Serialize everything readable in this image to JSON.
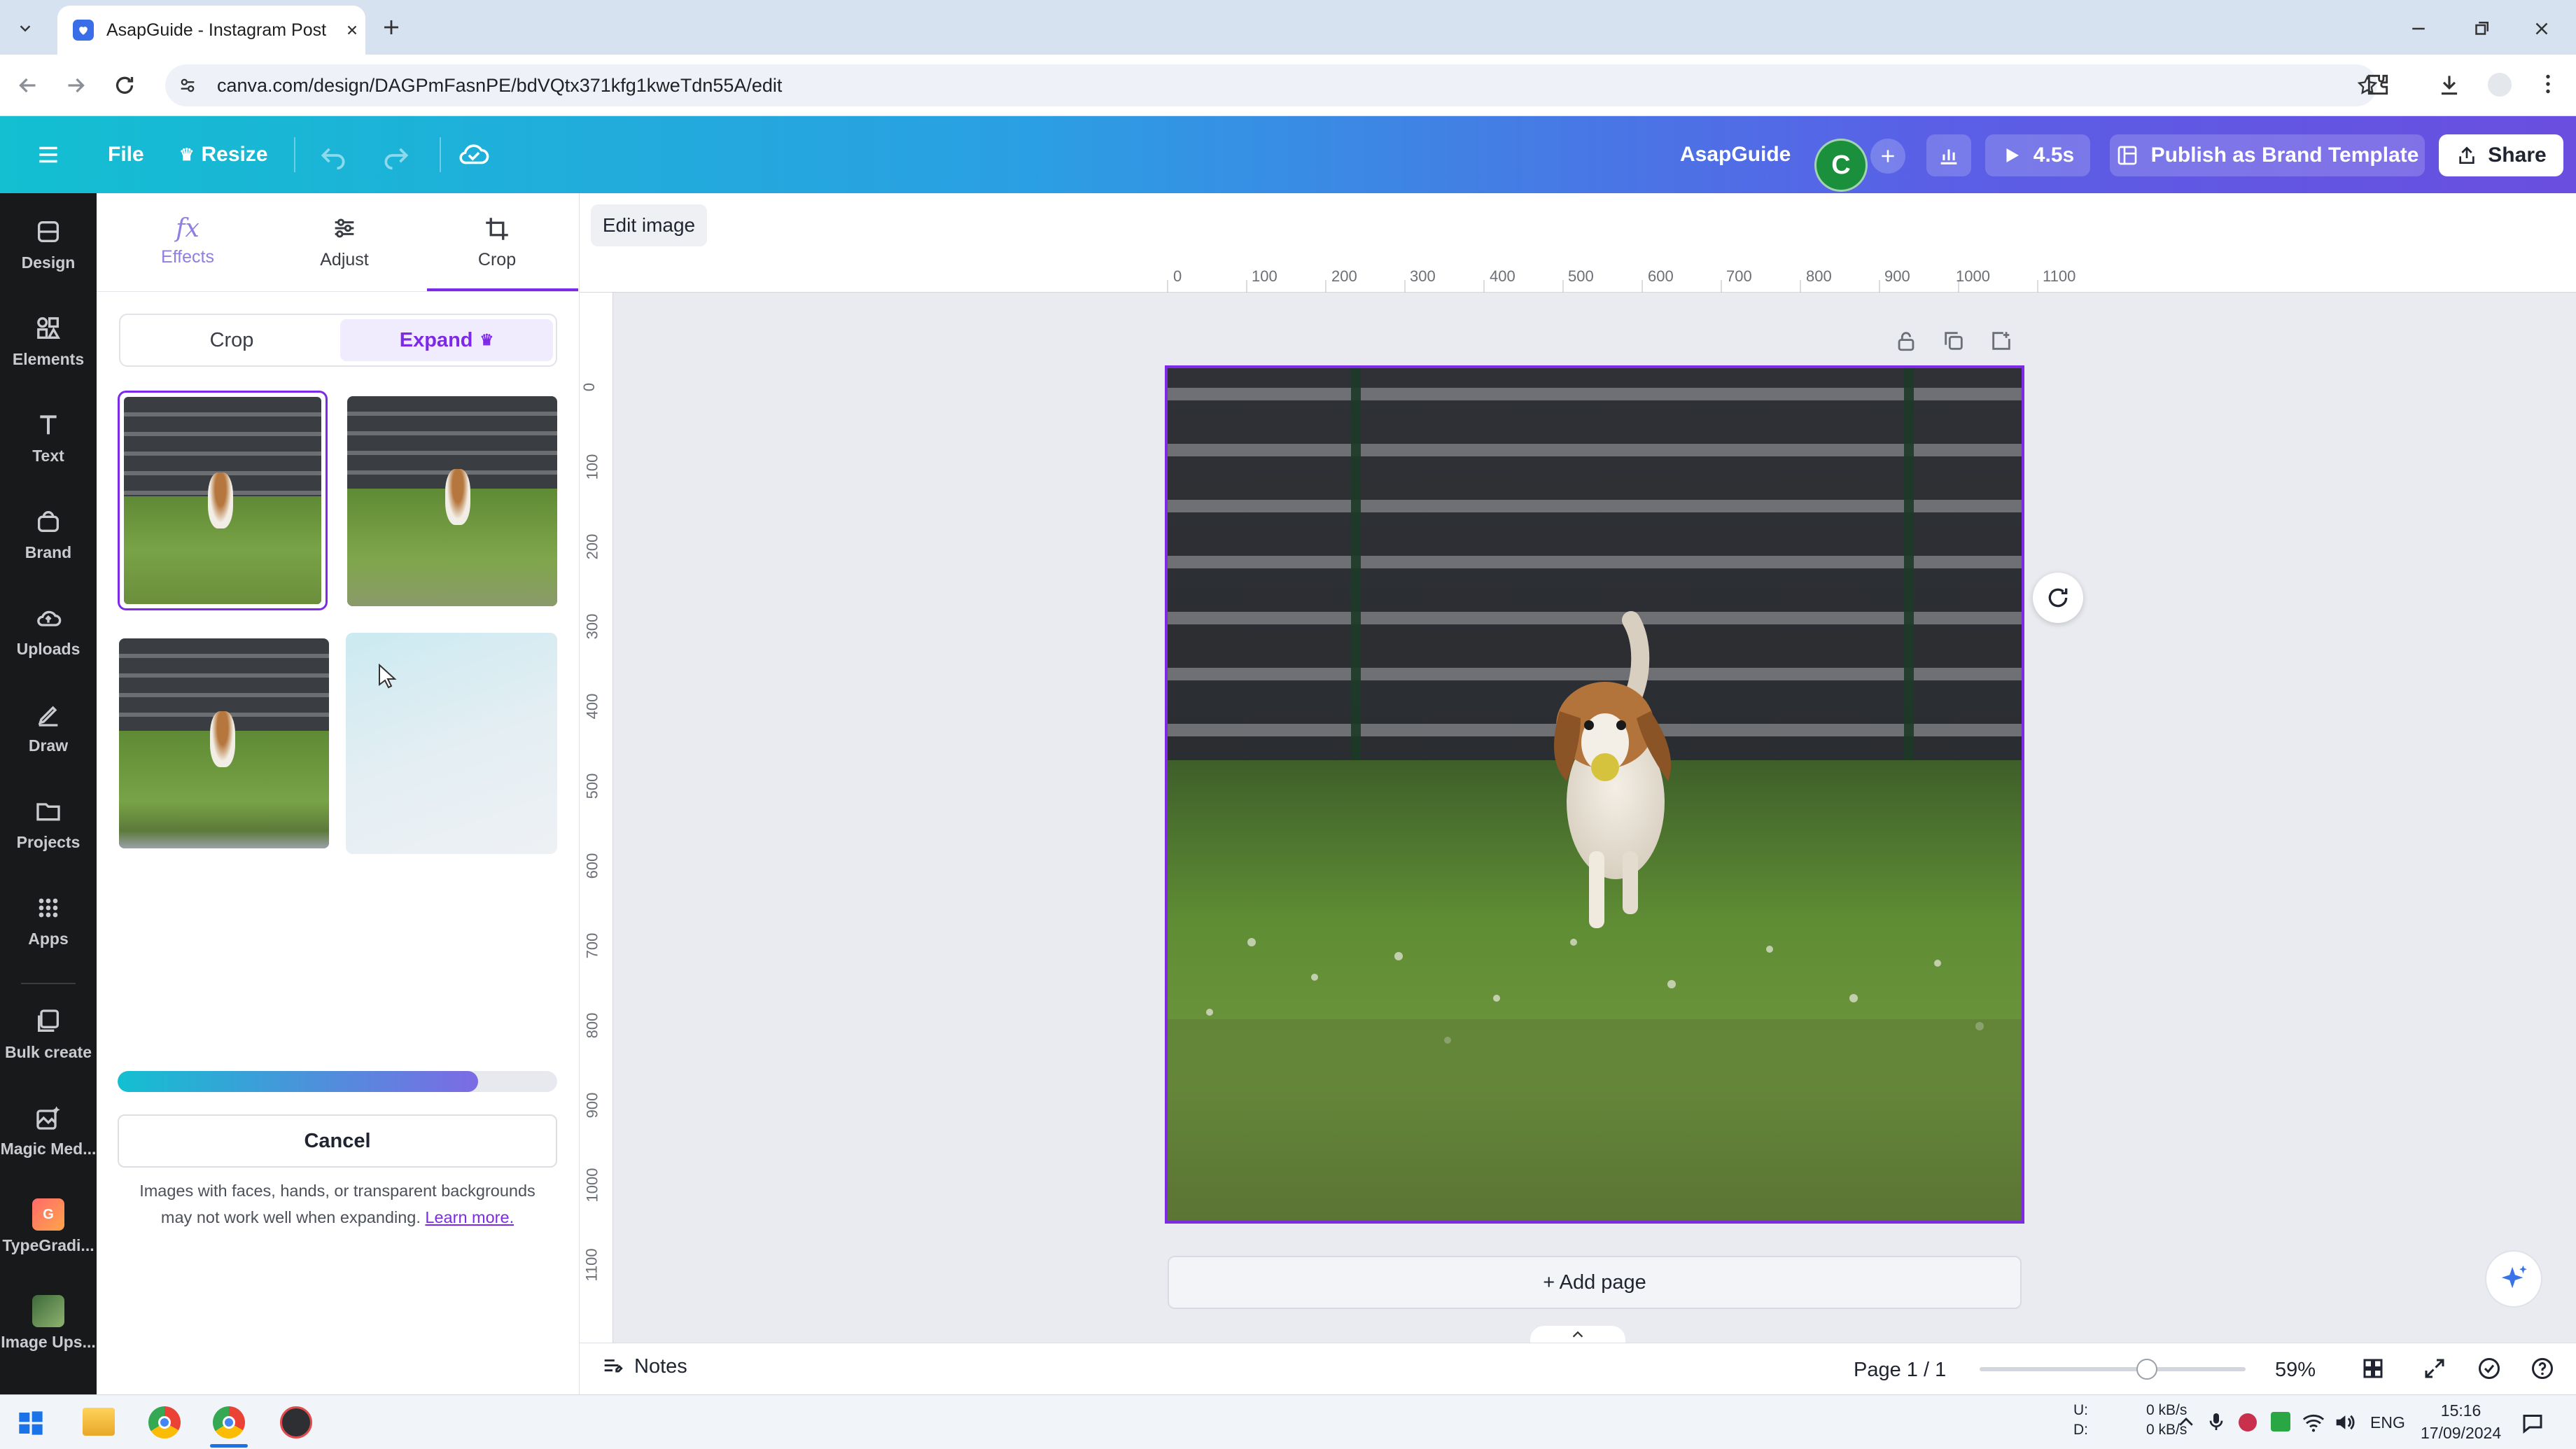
{
  "browser": {
    "tab_title": "AsapGuide - Instagram Post",
    "url": "canva.com/design/DAGPmFasnPE/bdVQtx371kfg1kweTdn55A/edit"
  },
  "header": {
    "file": "File",
    "resize": "Resize",
    "brand_name": "AsapGuide",
    "avatar_letter": "C",
    "play_time": "4.5s",
    "publish": "Publish as Brand Template",
    "share": "Share"
  },
  "rail": {
    "items": [
      {
        "label": "Design"
      },
      {
        "label": "Elements"
      },
      {
        "label": "Text"
      },
      {
        "label": "Brand"
      },
      {
        "label": "Uploads"
      },
      {
        "label": "Draw"
      },
      {
        "label": "Projects"
      },
      {
        "label": "Apps"
      },
      {
        "label": "Bulk create"
      },
      {
        "label": "Magic Med..."
      },
      {
        "label": "TypeGradi..."
      },
      {
        "label": "Image Ups..."
      }
    ]
  },
  "panel": {
    "tabs": [
      {
        "label": "Effects"
      },
      {
        "label": "Adjust"
      },
      {
        "label": "Crop"
      }
    ],
    "segment": {
      "crop": "Crop",
      "expand": "Expand"
    },
    "progress": 0.82,
    "cancel": "Cancel",
    "note": "Images with faces, hands, or transparent backgrounds may not work well when expanding.",
    "learn_more": "Learn more."
  },
  "canvas": {
    "edit_image": "Edit image",
    "ruler_top": [
      "0",
      "100",
      "200",
      "300",
      "400",
      "500",
      "600",
      "700",
      "800",
      "900",
      "1000",
      "1100"
    ],
    "ruler_left": [
      "0",
      "100",
      "200",
      "300",
      "400",
      "500",
      "600",
      "700",
      "800",
      "900",
      "1000",
      "1100"
    ],
    "add_page": "+ Add page"
  },
  "footer": {
    "notes": "Notes",
    "page": "Page 1 / 1",
    "zoom": "59%",
    "zoom_level": 0.59
  },
  "taskbar": {
    "net_up_label": "U:",
    "net_down_label": "D:",
    "net_up": "0 kB/s",
    "net_down": "0 kB/s",
    "lang": "ENG",
    "time": "15:16",
    "date": "17/09/2024"
  },
  "colors": {
    "accent_purple": "#7d2ae8",
    "header_start": "#13bfd1",
    "header_end": "#6a4ee0",
    "progress_start": "#13bfd1",
    "progress_end": "#7c6be4",
    "avatar_green": "#1a8f3c"
  }
}
